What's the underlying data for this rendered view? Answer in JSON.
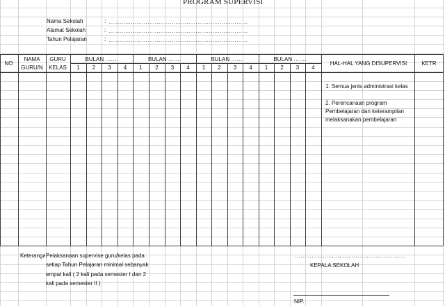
{
  "title": "PROGRAM SUPERVISI",
  "info": [
    {
      "label": "Nama Sekolah",
      "colon": ":",
      "dots": "……………………………………………………………………………"
    },
    {
      "label": "Alamat Sekolah",
      "colon": ":",
      "dots": "……………………………………………………………………………"
    },
    {
      "label": "Tahun Pelajaran",
      "colon": ":",
      "dots": "……………………………………………………………………………"
    }
  ],
  "headers": {
    "no": "NO",
    "nama_1": "NAMA",
    "nama_2": "GURU/N",
    "guru_1": "GURU",
    "guru_2": "KELAS",
    "bulan": [
      "BULAN …….",
      "BULAN …….",
      "BULAN …….",
      "BULAN ……."
    ],
    "weeks": [
      "1",
      "2",
      "3",
      "4"
    ],
    "hal": "HAL-HAL YANG DISUPERVISI",
    "ketr": "KETR"
  },
  "items": [
    "1. Semua jenis administrasi kelas",
    "2. Perencanaan program",
    "Pembelajaran dan keterampilan",
    "melaksanakan pembelajaran"
  ],
  "footer": {
    "keterangan_label": "Keterangan",
    "keterangan_lines": [
      "Pelaksanaan supervise guru/kelas pada",
      "setiap Tahun Pelajaran minimal sebanyak",
      "empat kali ( 2 kali pada semester I dan 2",
      "kali pada semester II )"
    ],
    "date_line": "……………………, ……………………………………",
    "kepala": "KEPALA SEKOLAH",
    "nip": "NIP."
  }
}
